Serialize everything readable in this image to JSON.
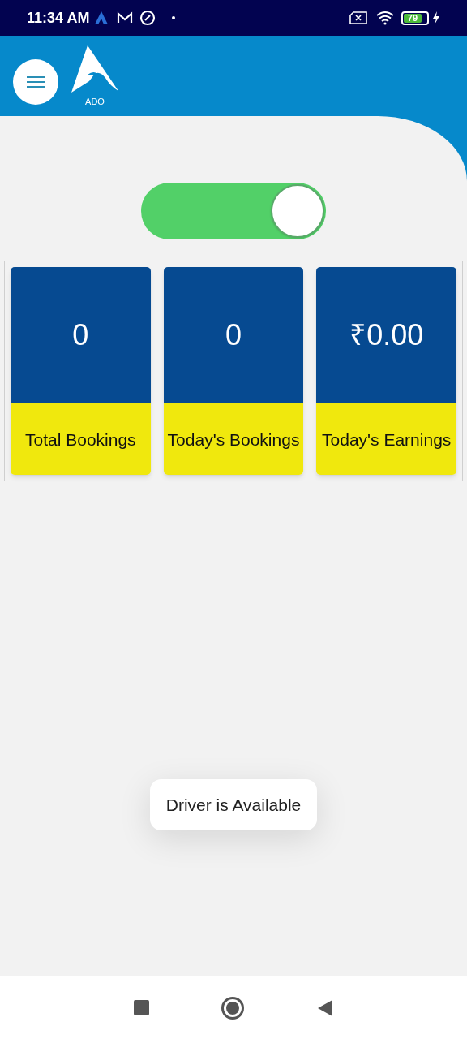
{
  "status_bar": {
    "time": "11:34 AM",
    "battery": "79"
  },
  "header": {
    "logo_text": "ADO"
  },
  "availability_toggle": {
    "on": true
  },
  "stats": [
    {
      "value": "0",
      "label": "Total Bookings"
    },
    {
      "value": "0",
      "label": "Today's Bookings"
    },
    {
      "value": "₹0.00",
      "label": "Today's Earnings"
    }
  ],
  "toast": {
    "message": "Driver is Available"
  }
}
